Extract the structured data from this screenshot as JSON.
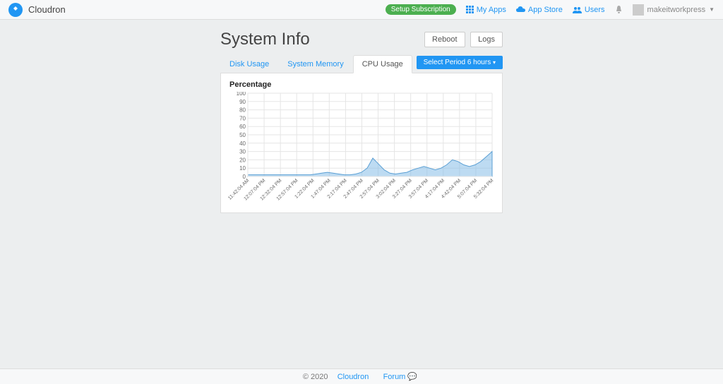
{
  "brand": "Cloudron",
  "nav": {
    "subscription": "Setup Subscription",
    "myapps": "My Apps",
    "appstore": "App Store",
    "users": "Users",
    "username": "makeitworkpress"
  },
  "page": {
    "title": "System Info",
    "reboot": "Reboot",
    "logs": "Logs"
  },
  "tabs": {
    "disk": "Disk Usage",
    "memory": "System Memory",
    "cpu": "CPU Usage"
  },
  "period_btn": "Select Period 6 hours",
  "chart_data": {
    "type": "area",
    "title": "Percentage",
    "ylabel": "",
    "ylim": [
      0,
      100
    ],
    "yticks": [
      0,
      10,
      20,
      30,
      40,
      50,
      60,
      70,
      80,
      90,
      100
    ],
    "categories": [
      "11:42:04 AM",
      "12:07:04 PM",
      "12:32:04 PM",
      "12:57:04 PM",
      "1:22:04 PM",
      "1:47:04 PM",
      "2:17:04 PM",
      "2:47:04 PM",
      "2:57:04 PM",
      "3:02:04 PM",
      "3:27:04 PM",
      "3:57:04 PM",
      "4:17:04 PM",
      "4:42:04 PM",
      "5:07:04 PM",
      "5:32:04 PM"
    ],
    "values": [
      2,
      2,
      2,
      2,
      2,
      2,
      2,
      2,
      2,
      2,
      2,
      2,
      3,
      4,
      5,
      4,
      3,
      2,
      2,
      3,
      5,
      10,
      22,
      15,
      8,
      4,
      3,
      4,
      5,
      8,
      10,
      12,
      10,
      8,
      10,
      14,
      20,
      18,
      14,
      12,
      14,
      18,
      24,
      30
    ]
  },
  "footer": {
    "copyright": "© 2020",
    "cloudron": "Cloudron",
    "forum": "Forum"
  }
}
